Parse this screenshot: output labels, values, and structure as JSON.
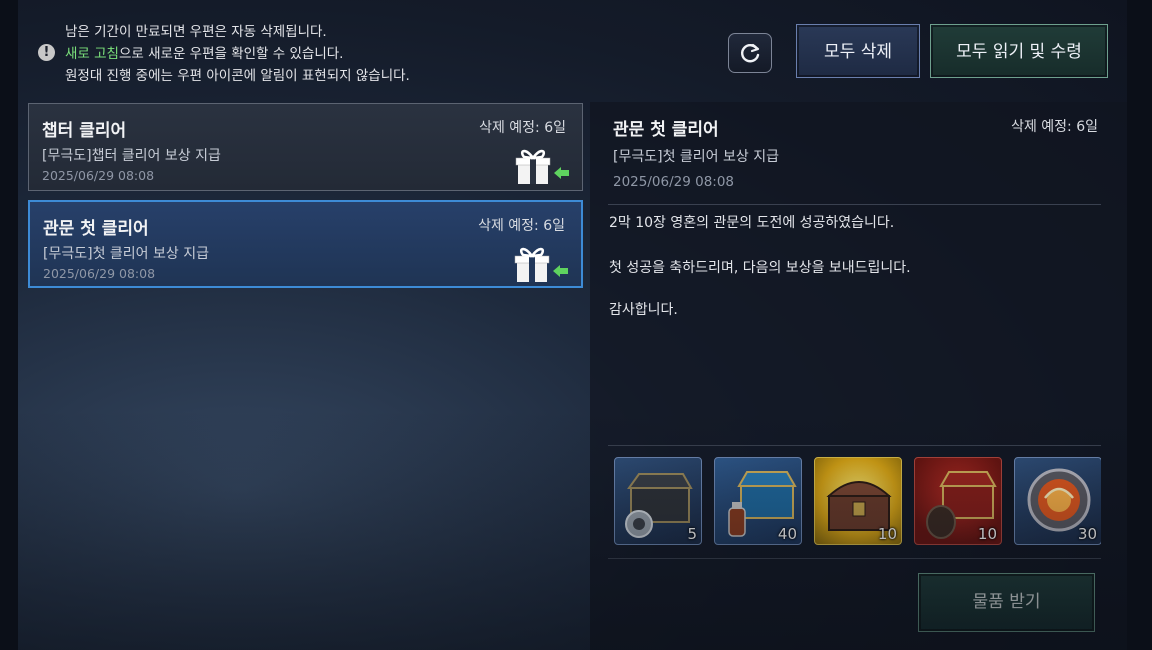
{
  "notice": {
    "line1": "남은 기간이 만료되면 우편은 자동 삭제됩니다.",
    "line2_highlight": "새로 고침",
    "line2_rest": "으로 새로운 우편을 확인할 수 있습니다.",
    "line3": "원정대 진행 중에는 우편 아이콘에 알림이 표현되지 않습니다.",
    "icon": "exclamation-icon"
  },
  "toolbar": {
    "refresh_icon": "refresh-icon",
    "delete_all_label": "모두 삭제",
    "read_all_label": "모두 읽기 및 수령"
  },
  "mails": [
    {
      "title": "챕터 클리어",
      "desc": "[무극도]챕터 클리어 보상 지급",
      "date": "2025/06/29 08:08",
      "expire": "삭제 예정: 6일",
      "icon": "gift-icon",
      "selected": false
    },
    {
      "title": "관문 첫 클리어",
      "desc": "[무극도]첫 클리어 보상 지급",
      "date": "2025/06/29 08:08",
      "expire": "삭제 예정: 6일",
      "icon": "gift-icon",
      "selected": true
    }
  ],
  "detail": {
    "title": "관문 첫 클리어",
    "expire": "삭제 예정: 6일",
    "desc": "[무극도]첫 클리어 보상 지급",
    "date": "2025/06/29 08:08",
    "body": [
      "2막 10장 영혼의 관문의 도전에 성공하였습니다.",
      "첫 성공을 축하드리며, 다음의 보상을 보내드립니다.",
      "감사합니다."
    ],
    "rewards": [
      {
        "icon": "dark-chest-icon",
        "qty": "5"
      },
      {
        "icon": "blue-chest-icon",
        "qty": "40"
      },
      {
        "icon": "gold-chest-icon",
        "qty": "10"
      },
      {
        "icon": "red-chest-icon",
        "qty": "10"
      },
      {
        "icon": "fire-orb-icon",
        "qty": "30"
      }
    ],
    "receive_label": "물품 받기"
  },
  "colors": {
    "highlight_green": "#7be07b",
    "selected_border": "#3d8bd6",
    "accent_teal": "#6ea08e"
  }
}
